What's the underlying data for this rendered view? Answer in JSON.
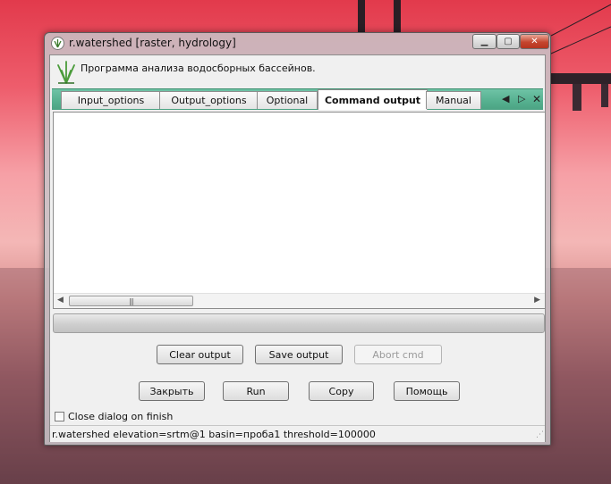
{
  "window": {
    "title": "r.watershed [raster, hydrology]"
  },
  "description": "Программа анализа водосборных бассейнов.",
  "tabs": [
    {
      "label": "Input_options"
    },
    {
      "label": "Output_options"
    },
    {
      "label": "Optional"
    },
    {
      "label": "Command output",
      "active": true
    },
    {
      "label": "Manual"
    }
  ],
  "output": {
    "text": ""
  },
  "progress": {
    "value": 0
  },
  "buttons": {
    "clear_output": "Clear output",
    "save_output": "Save output",
    "abort_cmd": "Abort cmd",
    "close": "Закрыть",
    "run": "Run",
    "copy": "Copy",
    "help": "Помощь"
  },
  "checkbox": {
    "close_dialog_label": "Close dialog on finish",
    "checked": false
  },
  "status": {
    "command": "r.watershed elevation=srtm@1 basin=проба1 threshold=100000"
  },
  "icons": {
    "title": "grass-icon",
    "logo": "grass-logo-icon",
    "tab_prev": "triangle-left-icon",
    "tab_next": "triangle-right-icon",
    "tab_close": "close-icon"
  },
  "colors": {
    "tab_bar": "#55b08f",
    "progress_fill": "#4fae4a"
  }
}
